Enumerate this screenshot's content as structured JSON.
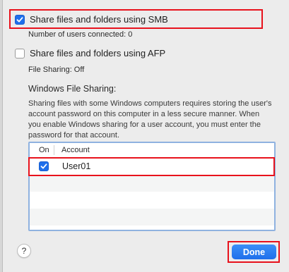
{
  "smb": {
    "label": "Share files and folders using SMB",
    "checked": true,
    "status": "Number of users connected: 0"
  },
  "afp": {
    "label": "Share files and folders using AFP",
    "checked": false,
    "status": "File Sharing: Off"
  },
  "windows": {
    "title": "Windows File Sharing:",
    "description": "Sharing files with some Windows computers requires storing the user's account password on this computer in a less secure manner.  When you enable Windows sharing for a user account, you must enter the password for that account."
  },
  "table": {
    "col_on": "On",
    "col_account": "Account",
    "rows": [
      {
        "on": true,
        "account": "User01"
      }
    ]
  },
  "buttons": {
    "help": "?",
    "done": "Done"
  },
  "colors": {
    "accent": "#1f6feb",
    "highlight": "#e8121c"
  }
}
